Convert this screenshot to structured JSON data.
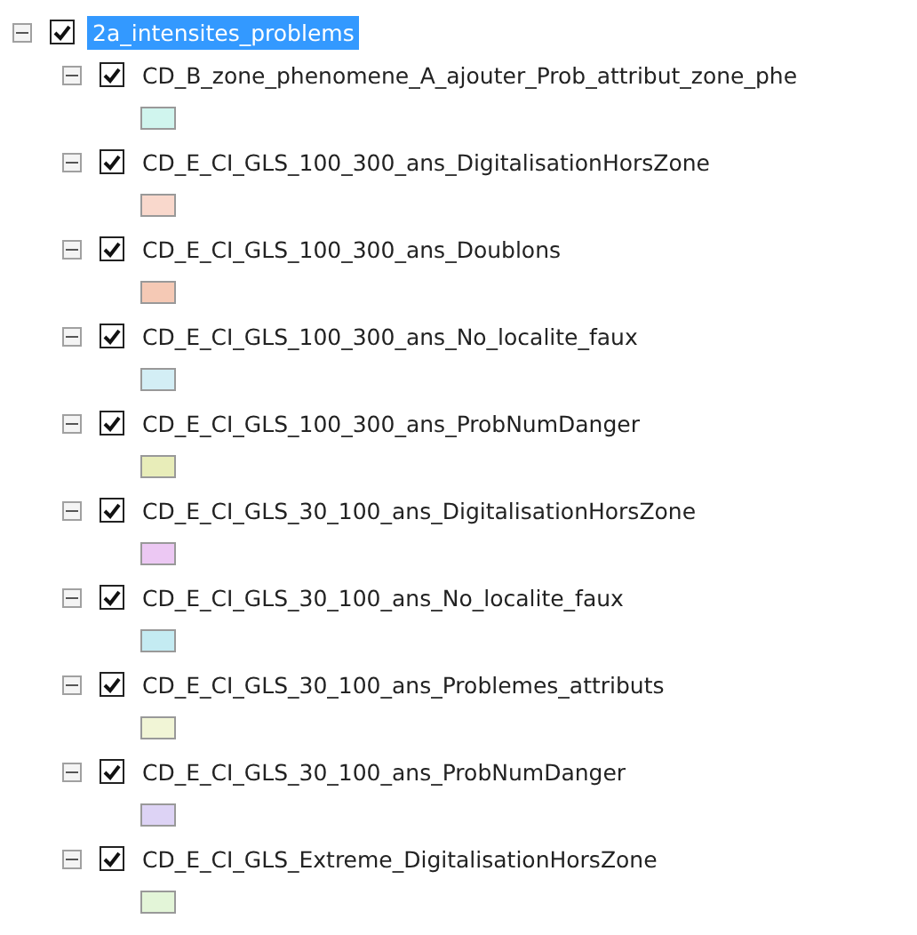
{
  "layer_tree": {
    "root": {
      "label": "2a_intensites_problems",
      "checked": true,
      "expanded": true,
      "selected": true
    },
    "children": [
      {
        "label": "CD_B_zone_phenomene_A_ajouter_Prob_attribut_zone_phe",
        "checked": true,
        "expanded": true,
        "color": "#d0f5ee"
      },
      {
        "label": "CD_E_CI_GLS_100_300_ans_DigitalisationHorsZone",
        "checked": true,
        "expanded": true,
        "color": "#f9d8cc"
      },
      {
        "label": "CD_E_CI_GLS_100_300_ans_Doublons",
        "checked": true,
        "expanded": true,
        "color": "#f5c9b5"
      },
      {
        "label": "CD_E_CI_GLS_100_300_ans_No_localite_faux",
        "checked": true,
        "expanded": true,
        "color": "#d3eef5"
      },
      {
        "label": "CD_E_CI_GLS_100_300_ans_ProbNumDanger",
        "checked": true,
        "expanded": true,
        "color": "#e8edb9"
      },
      {
        "label": "CD_E_CI_GLS_30_100_ans_DigitalisationHorsZone",
        "checked": true,
        "expanded": true,
        "color": "#ecc8f3"
      },
      {
        "label": "CD_E_CI_GLS_30_100_ans_No_localite_faux",
        "checked": true,
        "expanded": true,
        "color": "#c4ebf2"
      },
      {
        "label": "CD_E_CI_GLS_30_100_ans_Problemes_attributs",
        "checked": true,
        "expanded": true,
        "color": "#f1f5d6"
      },
      {
        "label": "CD_E_CI_GLS_30_100_ans_ProbNumDanger",
        "checked": true,
        "expanded": true,
        "color": "#ddd3f5"
      },
      {
        "label": "CD_E_CI_GLS_Extreme_DigitalisationHorsZone",
        "checked": true,
        "expanded": true,
        "color": "#e3f5d8"
      }
    ]
  }
}
